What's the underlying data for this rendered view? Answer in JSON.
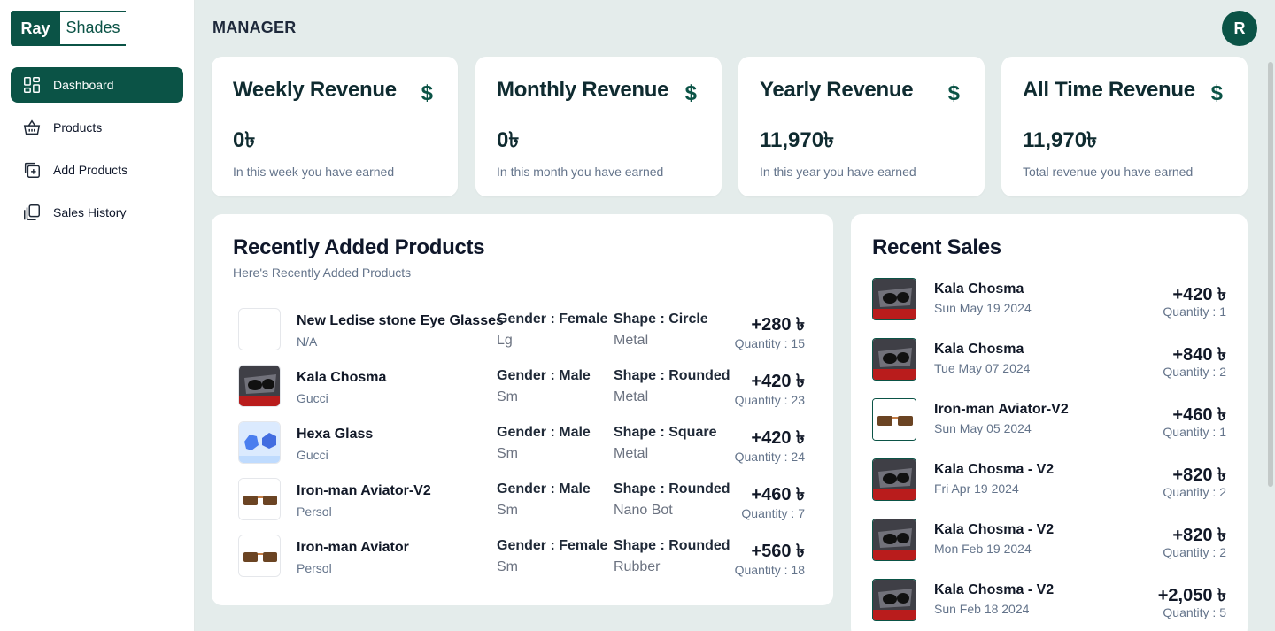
{
  "brand": {
    "part1": "Ray",
    "part2": "Shades"
  },
  "sidebar": {
    "items": [
      {
        "label": "Dashboard",
        "icon": "dashboard-icon",
        "active": true
      },
      {
        "label": "Products",
        "icon": "basket-icon",
        "active": false
      },
      {
        "label": "Add Products",
        "icon": "add-square-icon",
        "active": false
      },
      {
        "label": "Sales History",
        "icon": "copy-history-icon",
        "active": false
      }
    ]
  },
  "header": {
    "title": "MANAGER",
    "avatar_initial": "R"
  },
  "colors": {
    "accent": "#0b5346",
    "background": "#e4eceb",
    "card": "#ffffff"
  },
  "stats": [
    {
      "title": "Weekly Revenue",
      "icon": "dollar-icon",
      "symbol": "$",
      "value": "0৳",
      "desc": "In this week you have earned"
    },
    {
      "title": "Monthly Revenue",
      "icon": "dollar-icon",
      "symbol": "$",
      "value": "0৳",
      "desc": "In this month you have earned"
    },
    {
      "title": "Yearly Revenue",
      "icon": "dollar-icon",
      "symbol": "$",
      "value": "11,970৳",
      "desc": "In this year you have earned"
    },
    {
      "title": "All Time Revenue",
      "icon": "dollar-icon",
      "symbol": "$",
      "value": "11,970৳",
      "desc": "Total revenue you have earned"
    }
  ],
  "recent_products": {
    "title": "Recently Added Products",
    "subtitle": "Here's Recently Added Products",
    "items": [
      {
        "name": "New Ledise stone Eye Glasses",
        "brand": "N/A",
        "gender": "Gender : Female",
        "size": "Lg",
        "shape": "Shape : Circle",
        "material": "Metal",
        "price": "+280 ৳",
        "quantity": "Quantity : 15",
        "thumb": "blank"
      },
      {
        "name": "Kala Chosma",
        "brand": "Gucci",
        "gender": "Gender : Male",
        "size": "Sm",
        "shape": "Shape : Rounded",
        "material": "Metal",
        "price": "+420 ৳",
        "quantity": "Quantity : 23",
        "thumb": "dark"
      },
      {
        "name": "Hexa Glass",
        "brand": "Gucci",
        "gender": "Gender : Male",
        "size": "Sm",
        "shape": "Shape : Square",
        "material": "Metal",
        "price": "+420 ৳",
        "quantity": "Quantity : 24",
        "thumb": "blue"
      },
      {
        "name": "Iron-man Aviator-V2",
        "brand": "Persol",
        "gender": "Gender : Male",
        "size": "Sm",
        "shape": "Shape : Rounded",
        "material": "Nano Bot",
        "price": "+460 ৳",
        "quantity": "Quantity : 7",
        "thumb": "brown"
      },
      {
        "name": "Iron-man Aviator",
        "brand": "Persol",
        "gender": "Gender : Female",
        "size": "Sm",
        "shape": "Shape : Rounded",
        "material": "Rubber",
        "price": "+560 ৳",
        "quantity": "Quantity : 18",
        "thumb": "brown"
      }
    ]
  },
  "recent_sales": {
    "title": "Recent Sales",
    "items": [
      {
        "name": "Kala Chosma",
        "date": "Sun May 19 2024",
        "price": "+420 ৳",
        "quantity": "Quantity : 1",
        "thumb": "dark"
      },
      {
        "name": "Kala Chosma",
        "date": "Tue May 07 2024",
        "price": "+840 ৳",
        "quantity": "Quantity : 2",
        "thumb": "dark"
      },
      {
        "name": "Iron-man Aviator-V2",
        "date": "Sun May 05 2024",
        "price": "+460 ৳",
        "quantity": "Quantity : 1",
        "thumb": "brown"
      },
      {
        "name": "Kala Chosma - V2",
        "date": "Fri Apr 19 2024",
        "price": "+820 ৳",
        "quantity": "Quantity : 2",
        "thumb": "dark"
      },
      {
        "name": "Kala Chosma - V2",
        "date": "Mon Feb 19 2024",
        "price": "+820 ৳",
        "quantity": "Quantity : 2",
        "thumb": "dark"
      },
      {
        "name": "Kala Chosma - V2",
        "date": "Sun Feb 18 2024",
        "price": "+2,050 ৳",
        "quantity": "Quantity : 5",
        "thumb": "dark"
      }
    ]
  }
}
